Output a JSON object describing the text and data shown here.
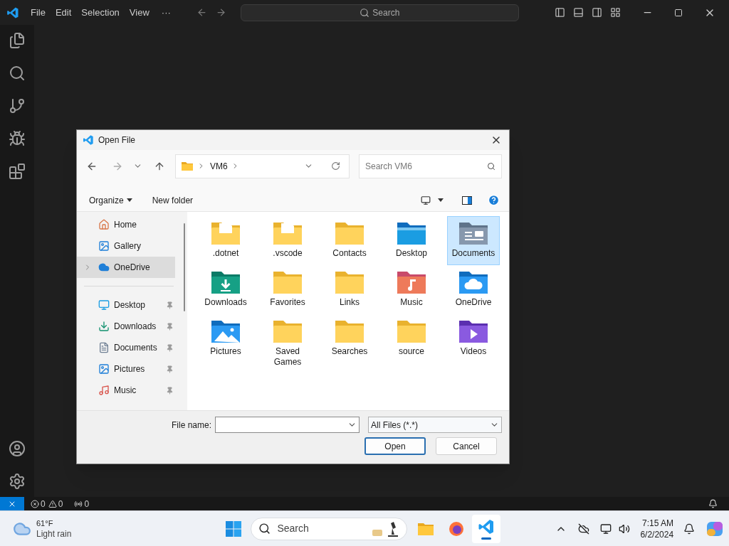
{
  "titlebar": {
    "menus": [
      "File",
      "Edit",
      "Selection",
      "View"
    ],
    "overflow": "···",
    "search": "Search"
  },
  "dialog": {
    "title": "Open File",
    "path": [
      "VM6"
    ],
    "search_placeholder": "Search VM6",
    "commands": [
      "Organize",
      "New folder"
    ],
    "nav_top": [
      {
        "label": "Home",
        "kind": "home",
        "selected": false,
        "expandable": false
      },
      {
        "label": "Gallery",
        "kind": "gallery",
        "selected": false,
        "expandable": false
      },
      {
        "label": "OneDrive",
        "kind": "onedrive",
        "selected": true,
        "expandable": true
      }
    ],
    "quick_access": [
      {
        "label": "Desktop",
        "kind": "desktop",
        "pinned": true
      },
      {
        "label": "Downloads",
        "kind": "downloads",
        "pinned": true
      },
      {
        "label": "Documents",
        "kind": "documents",
        "pinned": true
      },
      {
        "label": "Pictures",
        "kind": "pictures",
        "pinned": true
      },
      {
        "label": "Music",
        "kind": "music",
        "pinned": true
      }
    ],
    "files": [
      {
        "name": ".dotnet",
        "kind": "shortcut",
        "selected": false
      },
      {
        "name": ".vscode",
        "kind": "shortcut",
        "selected": false
      },
      {
        "name": "Contacts",
        "kind": "folder",
        "selected": false
      },
      {
        "name": "Desktop",
        "kind": "desktop",
        "selected": false
      },
      {
        "name": "Documents",
        "kind": "documents",
        "selected": true
      },
      {
        "name": "Downloads",
        "kind": "downloads",
        "selected": false
      },
      {
        "name": "Favorites",
        "kind": "folder",
        "selected": false
      },
      {
        "name": "Links",
        "kind": "folder",
        "selected": false
      },
      {
        "name": "Music",
        "kind": "music",
        "selected": false
      },
      {
        "name": "OneDrive",
        "kind": "onedrive",
        "selected": false
      },
      {
        "name": "Pictures",
        "kind": "pictures",
        "selected": false
      },
      {
        "name": "Saved Games",
        "kind": "folder",
        "selected": false
      },
      {
        "name": "Searches",
        "kind": "folder",
        "selected": false
      },
      {
        "name": "source",
        "kind": "folder",
        "selected": false
      },
      {
        "name": "Videos",
        "kind": "videos",
        "selected": false
      }
    ],
    "file_name_label": "File name:",
    "file_type": "All Files (*.*)",
    "buttons": [
      {
        "label": "Open",
        "default": true
      },
      {
        "label": "Cancel",
        "default": false
      }
    ]
  },
  "status_bar": {
    "errors": "0",
    "warnings": "0",
    "ports": "0"
  },
  "taskbar": {
    "temperature": "61°F",
    "condition": "Light rain",
    "search": "Search",
    "time": "7:15 AM",
    "date": "6/2/2024"
  }
}
